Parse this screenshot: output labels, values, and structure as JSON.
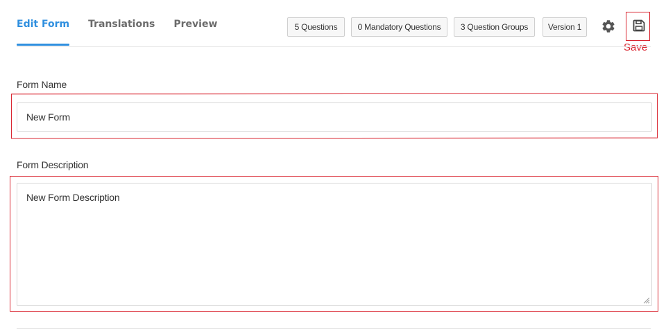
{
  "tabs": [
    {
      "label": "Edit Form",
      "active": true
    },
    {
      "label": "Translations",
      "active": false
    },
    {
      "label": "Preview",
      "active": false
    }
  ],
  "badges": {
    "questions": "5 Questions",
    "mandatory": "0 Mandatory Questions",
    "groups": "3 Question Groups",
    "version": "Version 1"
  },
  "toolbar": {
    "settings_icon": "gear-icon",
    "save_icon": "floppy-disk-icon",
    "save_label": "Save"
  },
  "form": {
    "name_label": "Form Name",
    "name_value": "New Form",
    "description_label": "Form Description",
    "description_value": "New Form Description"
  },
  "colors": {
    "accent": "#2f8fdf",
    "annotation": "#d9242f"
  }
}
